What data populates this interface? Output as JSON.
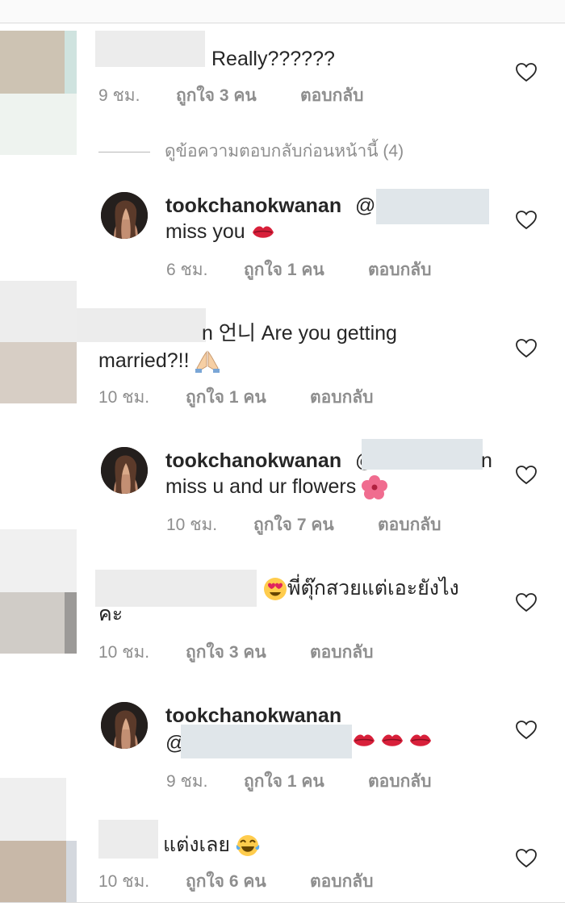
{
  "comments": [
    {
      "username": "",
      "text": "Really??????",
      "time": "9 ชม.",
      "likes": "ถูกใจ 3 คน",
      "reply": "ตอบกลับ",
      "icon": "heart-icon"
    },
    {
      "view_previous": "ดูข้อความตอบกลับก่อนหน้านี้ (4)"
    },
    {
      "username": "tookchanokwanan",
      "mention": "@",
      "text": "miss you",
      "emoji": "kiss-mark-emoji",
      "time": "6 ชม.",
      "likes": "ถูกใจ 1 คน",
      "reply": "ตอบกลับ"
    },
    {
      "username": "",
      "text_line1": "n 언니 Are you getting",
      "text_line2": "married?!!",
      "emoji": "folded-hands-emoji",
      "time": "10 ชม.",
      "likes": "ถูกใจ 1 คน",
      "reply": "ตอบกลับ"
    },
    {
      "username": "tookchanokwanan",
      "mention": "@",
      "mention_tail": "n",
      "text": "miss u and ur flowers",
      "emoji": "hibiscus-emoji",
      "time": "10 ชม.",
      "likes": "ถูกใจ 7 คน",
      "reply": "ตอบกลับ"
    },
    {
      "username": "",
      "text_line1": "พี่ตุ๊กสวยแต่เอะยังไง",
      "text_line2": "คะ",
      "emoji": "heart-eyes-emoji",
      "time": "10 ชม.",
      "likes": "ถูกใจ 3 คน",
      "reply": "ตอบกลับ"
    },
    {
      "username": "tookchanokwanan",
      "mention": "@",
      "emoji": "kiss-mark-emoji x3",
      "time": "9 ชม.",
      "likes": "ถูกใจ 1 คน",
      "reply": "ตอบกลับ"
    },
    {
      "username": "",
      "text": "แต่งเลย",
      "emoji": "tears-of-joy-emoji",
      "time": "10 ชม.",
      "likes": "ถูกใจ 6 คน",
      "reply": "ตอบกลับ"
    }
  ],
  "colors": {
    "text": "#262626",
    "meta": "#8e8e8e",
    "redacted": "#e6e8ea",
    "kiss": "#d8203a"
  }
}
